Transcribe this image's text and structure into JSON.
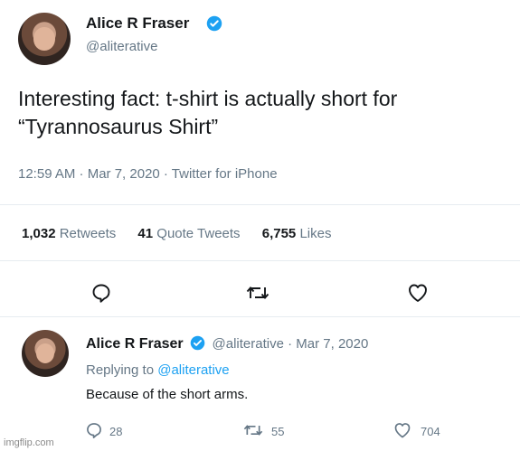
{
  "tweet": {
    "author_name": "Alice R Fraser",
    "author_handle": "@aliterative",
    "text_line1": "Interesting fact: t-shirt is actually short for",
    "text_line2": "“Tyrannosaurus Shirt”",
    "timestamp": "12:59 AM · Mar 7, 2020 · Twitter for iPhone",
    "stats": {
      "retweets_count": "1,032",
      "retweets_label": "Retweets",
      "quotes_count": "41",
      "quotes_label": "Quote Tweets",
      "likes_count": "6,755",
      "likes_label": "Likes"
    },
    "actions": {
      "reply_icon": "comment-icon",
      "retweet_icon": "retweet-icon",
      "like_icon": "heart-icon"
    }
  },
  "reply": {
    "author_name": "Alice R Fraser",
    "author_handle_date": "@aliterative · Mar 7, 2020",
    "replying_to_label": "Replying to",
    "replying_to_handle": "@aliterative",
    "text": "Because of the short arms.",
    "counts": {
      "replies": "28",
      "retweets": "55",
      "likes": "704"
    }
  },
  "watermark": "imgflip.com",
  "colors": {
    "accent": "#1da1f2",
    "text": "#14171a",
    "secondary": "#657786",
    "divider": "#e6ecf0"
  }
}
